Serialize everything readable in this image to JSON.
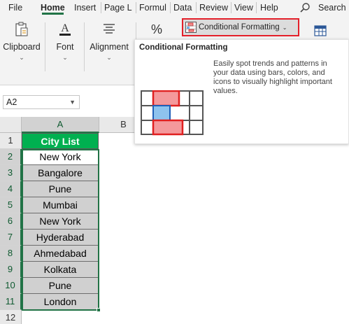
{
  "tabs": [
    "File",
    "Home",
    "Insert",
    "Page L",
    "Formul",
    "Data",
    "Review",
    "View",
    "Help"
  ],
  "active_tab": "Home",
  "search_label": "Search",
  "ribbon": {
    "clipboard_label": "Clipboard",
    "font_label": "Font",
    "alignment_label": "Alignment",
    "number_label": "%",
    "conditional_formatting_label": "Conditional Formatting"
  },
  "tooltip": {
    "title": "Conditional Formatting",
    "description": "Easily spot trends and patterns in your data using bars, colors, and icons to visually highlight important values."
  },
  "name_box": "A2",
  "columns": [
    "A",
    "B"
  ],
  "rows": [
    "1",
    "2",
    "3",
    "4",
    "5",
    "6",
    "7",
    "8",
    "9",
    "10",
    "11",
    "12"
  ],
  "column_a": {
    "header": "City List",
    "cities": [
      "New York",
      "Bangalore",
      "Pune",
      "Mumbai",
      "New York",
      "Hyderabad",
      "Ahmedabad",
      "Kolkata",
      "Pune",
      "London"
    ]
  },
  "colors": {
    "accent_green": "#217346",
    "header_fill": "#00b050",
    "highlight_red": "#e4202a"
  }
}
